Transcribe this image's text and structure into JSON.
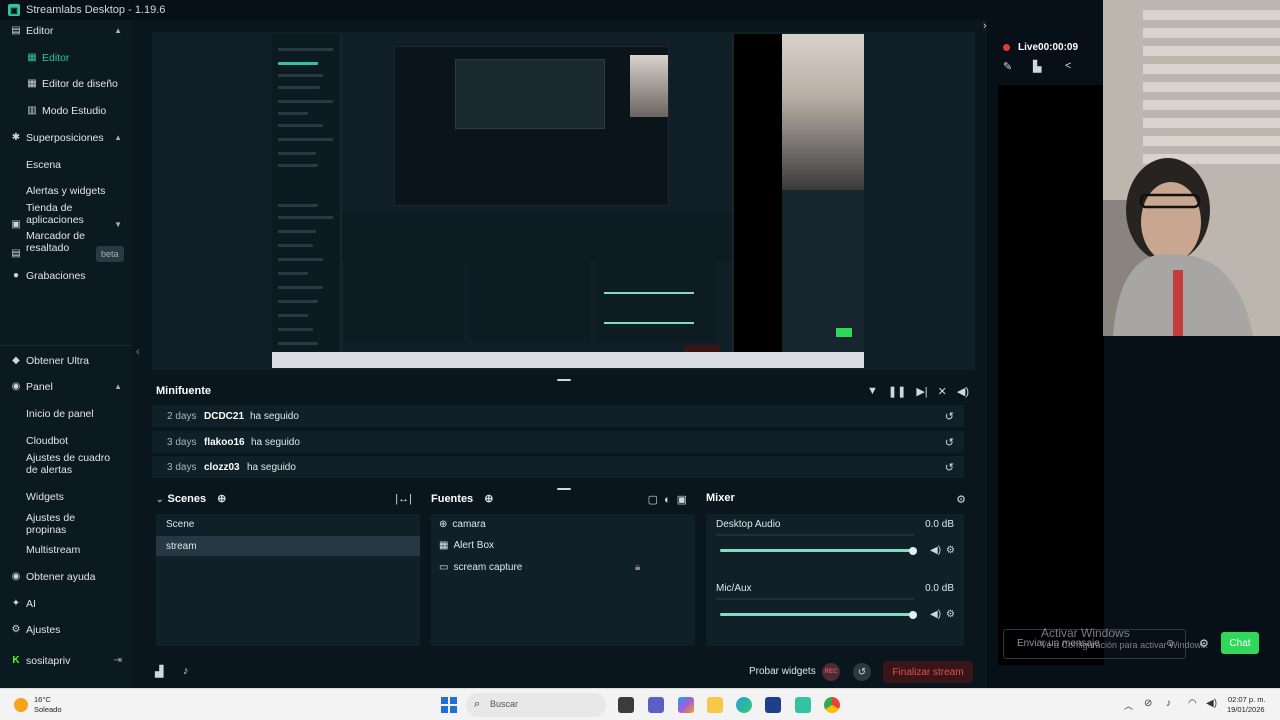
{
  "window": {
    "title": "Streamlabs Desktop - 1.19.6"
  },
  "sidebar": {
    "items": [
      {
        "label": "Editor",
        "icon": "editor-icon",
        "type": "section"
      },
      {
        "label": "Editor",
        "icon": "layout-icon",
        "type": "sub",
        "active": true
      },
      {
        "label": "Editor de diseño",
        "icon": "grid-icon",
        "type": "sub"
      },
      {
        "label": "Modo Estudio",
        "icon": "studio-icon",
        "type": "sub"
      },
      {
        "label": "Superposiciones",
        "icon": "overlays-icon",
        "type": "section"
      },
      {
        "label": "Escena",
        "type": "sub"
      },
      {
        "label": "Alertas y widgets",
        "type": "sub"
      },
      {
        "label": "Tienda de aplicaciones",
        "icon": "store-icon",
        "type": "section"
      },
      {
        "label": "Marcador de resaltado",
        "icon": "highlighter-icon",
        "type": "item",
        "badge": "beta"
      },
      {
        "label": "Grabaciones",
        "icon": "recordings-icon",
        "type": "item"
      }
    ],
    "bottom_items": [
      {
        "label": "Obtener Ultra",
        "icon": "ultra-icon"
      },
      {
        "label": "Panel",
        "icon": "dashboard-icon",
        "type": "section"
      },
      {
        "label": "Inicio de panel",
        "type": "sub"
      },
      {
        "label": "Cloudbot",
        "type": "sub"
      },
      {
        "label": "Ajustes de cuadro de alertas",
        "type": "sub"
      },
      {
        "label": "Widgets",
        "type": "sub"
      },
      {
        "label": "Ajustes de propinas",
        "type": "sub"
      },
      {
        "label": "Multistream",
        "type": "sub"
      },
      {
        "label": "Obtener ayuda",
        "icon": "help-icon"
      },
      {
        "label": "AI",
        "icon": "ai-icon"
      },
      {
        "label": "Ajustes",
        "icon": "settings-icon"
      },
      {
        "label": "sositapriv",
        "icon": "kick-icon"
      }
    ]
  },
  "minifuente": {
    "title": "Minifuente",
    "events": [
      {
        "ago": "2 days",
        "user": "DCDC21",
        "action": "ha seguido"
      },
      {
        "ago": "3 days",
        "user": "flakoo16",
        "action": "ha seguido"
      },
      {
        "ago": "3 days",
        "user": "clozz03",
        "action": "ha seguido"
      }
    ]
  },
  "scenes": {
    "title": "Scenes",
    "items": [
      "Scene",
      "stream"
    ],
    "selected": "stream"
  },
  "sources": {
    "title": "Fuentes",
    "items": [
      {
        "label": "camara",
        "icon": "globe-icon"
      },
      {
        "label": "Alert Box",
        "icon": "widget-icon"
      },
      {
        "label": "scream capture",
        "icon": "monitor-icon"
      }
    ]
  },
  "mixer": {
    "title": "Mixer",
    "channels": [
      {
        "name": "Desktop Audio",
        "db": "0.0 dB",
        "level": 1.0
      },
      {
        "name": "Mic/Aux",
        "db": "0.0 dB",
        "level": 1.0
      }
    ]
  },
  "bottombar": {
    "test_widgets": "Probar widgets",
    "rec": "REC",
    "end_stream": "Finalizar stream"
  },
  "live": {
    "status": "Live",
    "time": "00:00:09"
  },
  "chat": {
    "placeholder": "Enviar un mensaje",
    "button": "Chat"
  },
  "watermark": {
    "line1": "Activar Windows",
    "line2": "Ve a Configuración para activar Windows."
  },
  "taskbar": {
    "weather_temp": "16°C",
    "weather_desc": "Soleado",
    "search": "Buscar",
    "time": "02:07 p. m.",
    "date": "19/01/2026"
  },
  "colors": {
    "accent": "#31c3a2",
    "live": "#e03c3c",
    "end_stream": "#e0504f",
    "chat_button": "#2fd85a"
  }
}
